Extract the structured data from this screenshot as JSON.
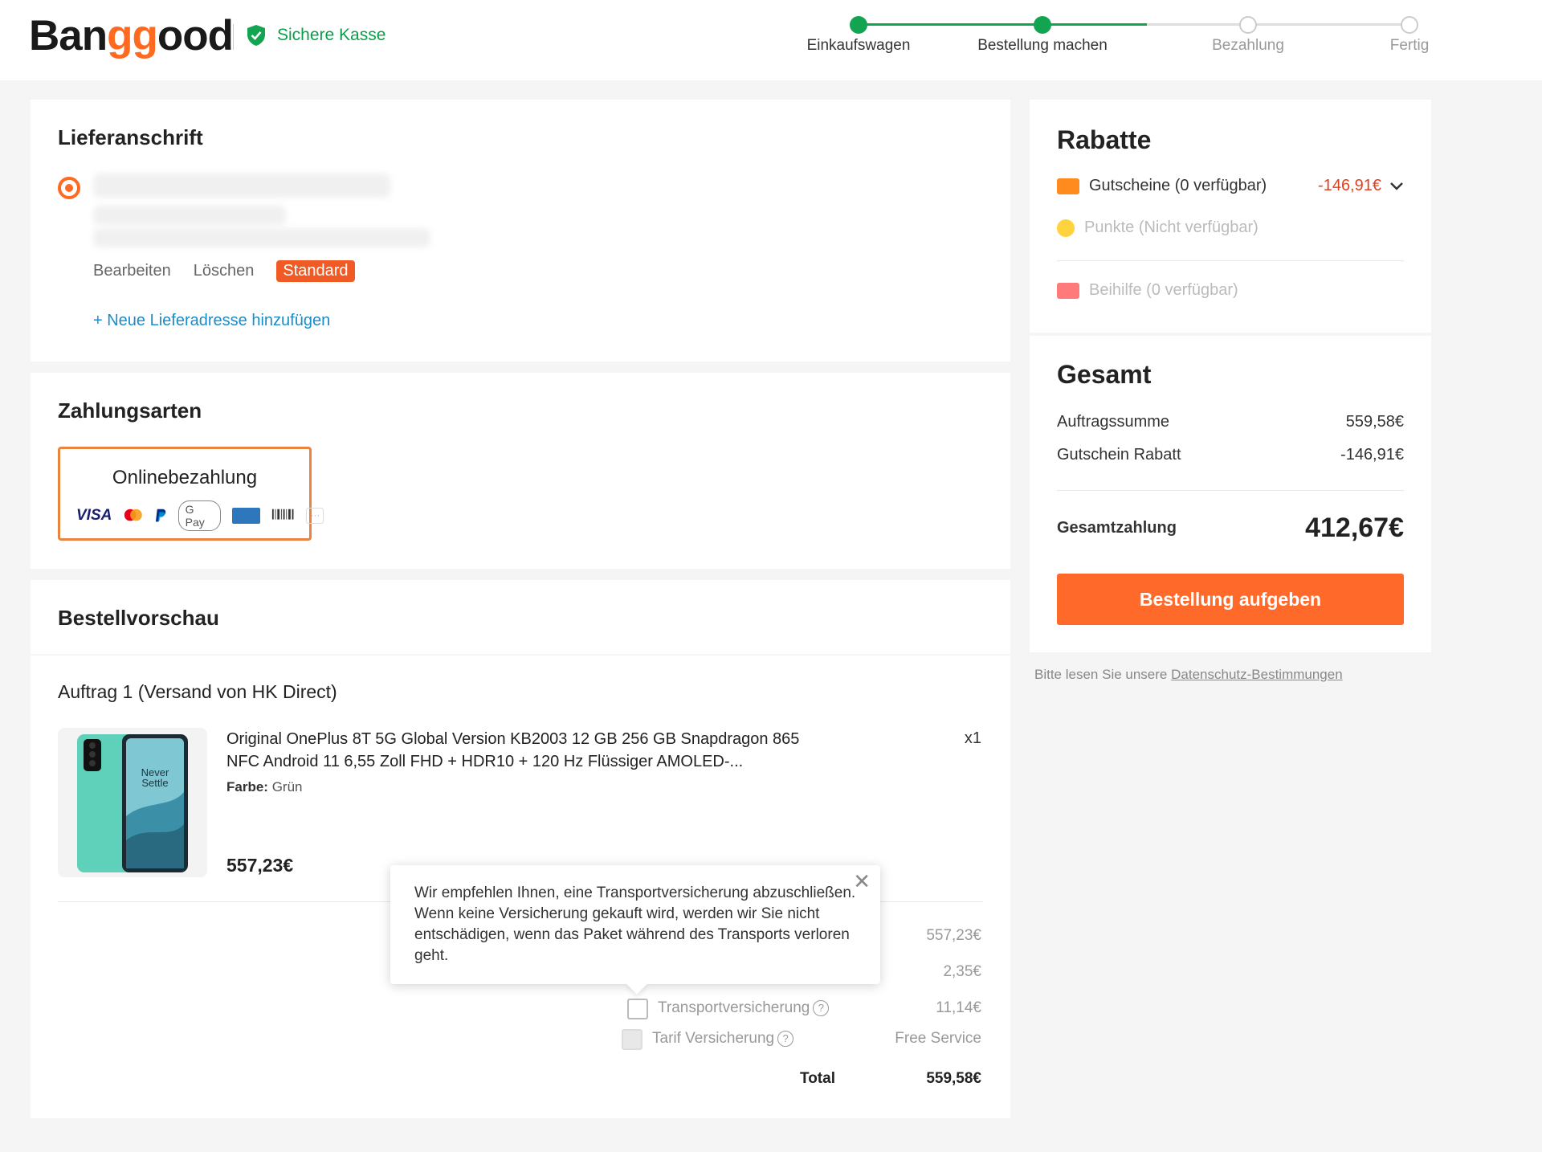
{
  "header": {
    "logo_prefix": "Ban",
    "logo_gg": "gg",
    "logo_suffix": "ood",
    "secure_label": "Sichere Kasse",
    "steps": [
      {
        "label": "Einkaufswagen",
        "done": true
      },
      {
        "label": "Bestellung machen",
        "done": true
      },
      {
        "label": "Bezahlung",
        "done": false
      },
      {
        "label": "Fertig",
        "done": false
      }
    ]
  },
  "address": {
    "title": "Lieferanschrift",
    "edit_label": "Bearbeiten",
    "delete_label": "Löschen",
    "default_badge": "Standard",
    "add_label": "+ Neue Lieferadresse hinzufügen"
  },
  "payment": {
    "title": "Zahlungsarten",
    "option_label": "Onlinebezahlung",
    "logos": [
      "VISA",
      "mastercard",
      "paypal",
      "G Pay",
      "amex",
      "boleto",
      "more"
    ]
  },
  "preview": {
    "title": "Bestellvorschau",
    "order_title": "Auftrag 1 (Versand von HK Direct)",
    "product": {
      "title": "Original OnePlus 8T 5G Global Version KB2003 12 GB 256 GB Snapdragon 865 NFC Android 11 6,55 Zoll FHD + HDR10 + 120 Hz Flüssiger AMOLED-...",
      "qty": "x1",
      "color_label": "Farbe:",
      "color_value": "Grün",
      "price": "557,23€",
      "screen_text_1": "Never",
      "screen_text_2": "Settle"
    },
    "summary": {
      "subtotal": "557,23€",
      "shipping": "2,35€",
      "insurance_label": "Transportversicherung",
      "insurance_value": "11,14€",
      "tariff_label": "Tarif Versicherung",
      "tariff_value": "Free Service",
      "total_label": "Total",
      "total_value": "559,58€"
    },
    "tooltip": "Wir empfehlen Ihnen, eine Transportversicherung abzuschließen. Wenn keine Versicherung gekauft wird, werden wir Sie nicht entschädigen, wenn das Paket während des Transports verloren geht."
  },
  "rabatte": {
    "title": "Rabatte",
    "coupons_label": "Gutscheine (0 verfügbar)",
    "coupons_value": "-146,91€",
    "points_label": "Punkte (Nicht verfügbar)",
    "allowance_label": "Beihilfe (0 verfügbar)"
  },
  "gesamt": {
    "title": "Gesamt",
    "order_sum_label": "Auftragssumme",
    "order_sum_value": "559,58€",
    "coupon_discount_label": "Gutschein Rabatt",
    "coupon_discount_value": "-146,91€",
    "total_label": "Gesamtzahlung",
    "total_value": "412,67€",
    "button_label": "Bestellung aufgeben"
  },
  "footer": {
    "privacy_prefix": "Bitte lesen Sie unsere",
    "privacy_link": "Datenschutz-Bestimmungen"
  },
  "colors": {
    "brand_orange": "#ff6a21",
    "success_green": "#13a452",
    "link_blue": "#1a8cc9",
    "discount_red": "#e0401e"
  }
}
